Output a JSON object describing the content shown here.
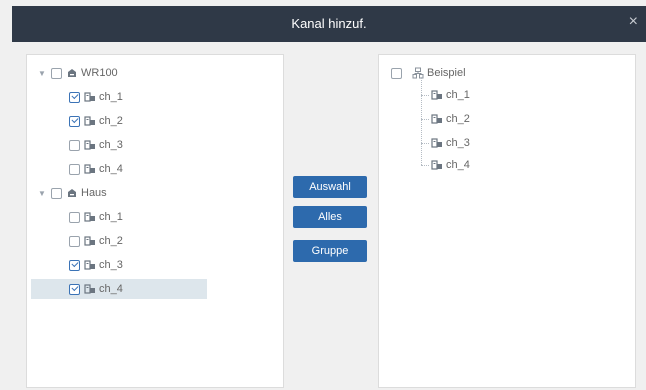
{
  "dialog": {
    "title": "Kanal hinzuf.",
    "close_glyph": "×"
  },
  "left_tree": {
    "groups": [
      {
        "label": "WR100",
        "icon": "device-icon",
        "expanded": true,
        "checked": false,
        "channels": [
          {
            "label": "ch_1",
            "checked": true
          },
          {
            "label": "ch_2",
            "checked": true
          },
          {
            "label": "ch_3",
            "checked": false
          },
          {
            "label": "ch_4",
            "checked": false
          }
        ]
      },
      {
        "label": "Haus",
        "icon": "device-icon",
        "expanded": true,
        "checked": false,
        "channels": [
          {
            "label": "ch_1",
            "checked": false
          },
          {
            "label": "ch_2",
            "checked": false
          },
          {
            "label": "ch_3",
            "checked": true
          },
          {
            "label": "ch_4",
            "checked": true
          }
        ]
      }
    ],
    "selected_channel": "Haus/ch_4"
  },
  "buttons": {
    "select": "Auswahl",
    "all": "Alles",
    "group": "Gruppe"
  },
  "right_tree": {
    "group_label": "Beispiel",
    "group_icon": "group-icon",
    "channels": [
      "ch_1",
      "ch_2",
      "ch_3",
      "ch_4"
    ]
  },
  "colors": {
    "titlebar": "#2f3947",
    "button": "#2d6aad",
    "selection": "#dde6ec",
    "check": "#3b73b6"
  }
}
